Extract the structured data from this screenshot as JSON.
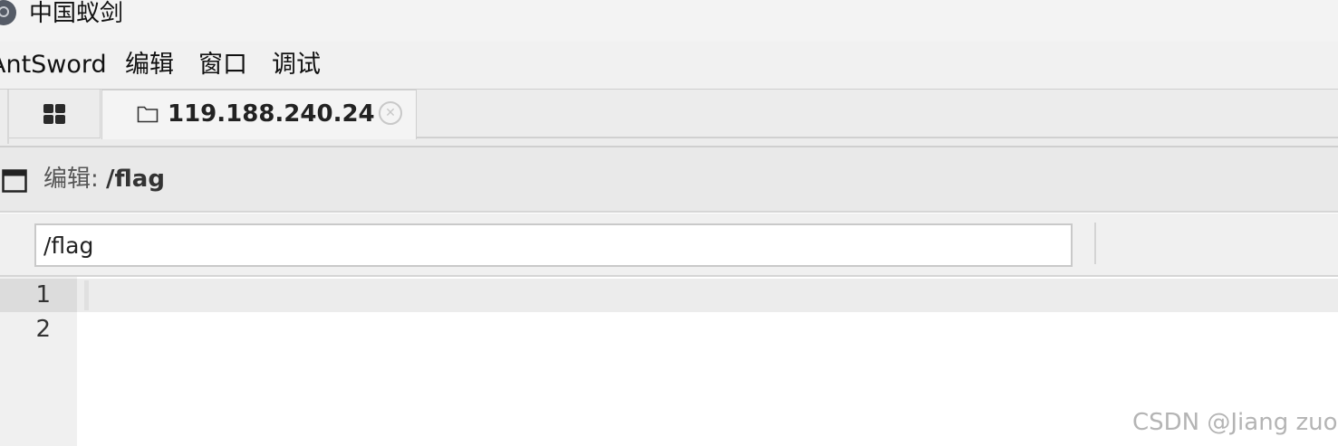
{
  "app": {
    "title": "中国蚁剑"
  },
  "menubar": {
    "items": [
      "AntSword",
      "编辑",
      "窗口",
      "调试"
    ]
  },
  "tabs": {
    "active_label": "119.188.240.24",
    "close_glyph": "✕"
  },
  "panel": {
    "title_prefix": "编辑: ",
    "title_path": "/flag"
  },
  "pathbar": {
    "value": "/flag"
  },
  "editor": {
    "line_numbers": [
      "1",
      "2"
    ]
  },
  "watermark": {
    "text": "CSDN @Jiang zuo"
  },
  "icons": {
    "app_logo": "antsword-logo-icon",
    "home_tab": "grid-icon",
    "tab_folder": "folder-icon",
    "tab_close": "close-circle-icon",
    "panel_window": "window-icon"
  }
}
